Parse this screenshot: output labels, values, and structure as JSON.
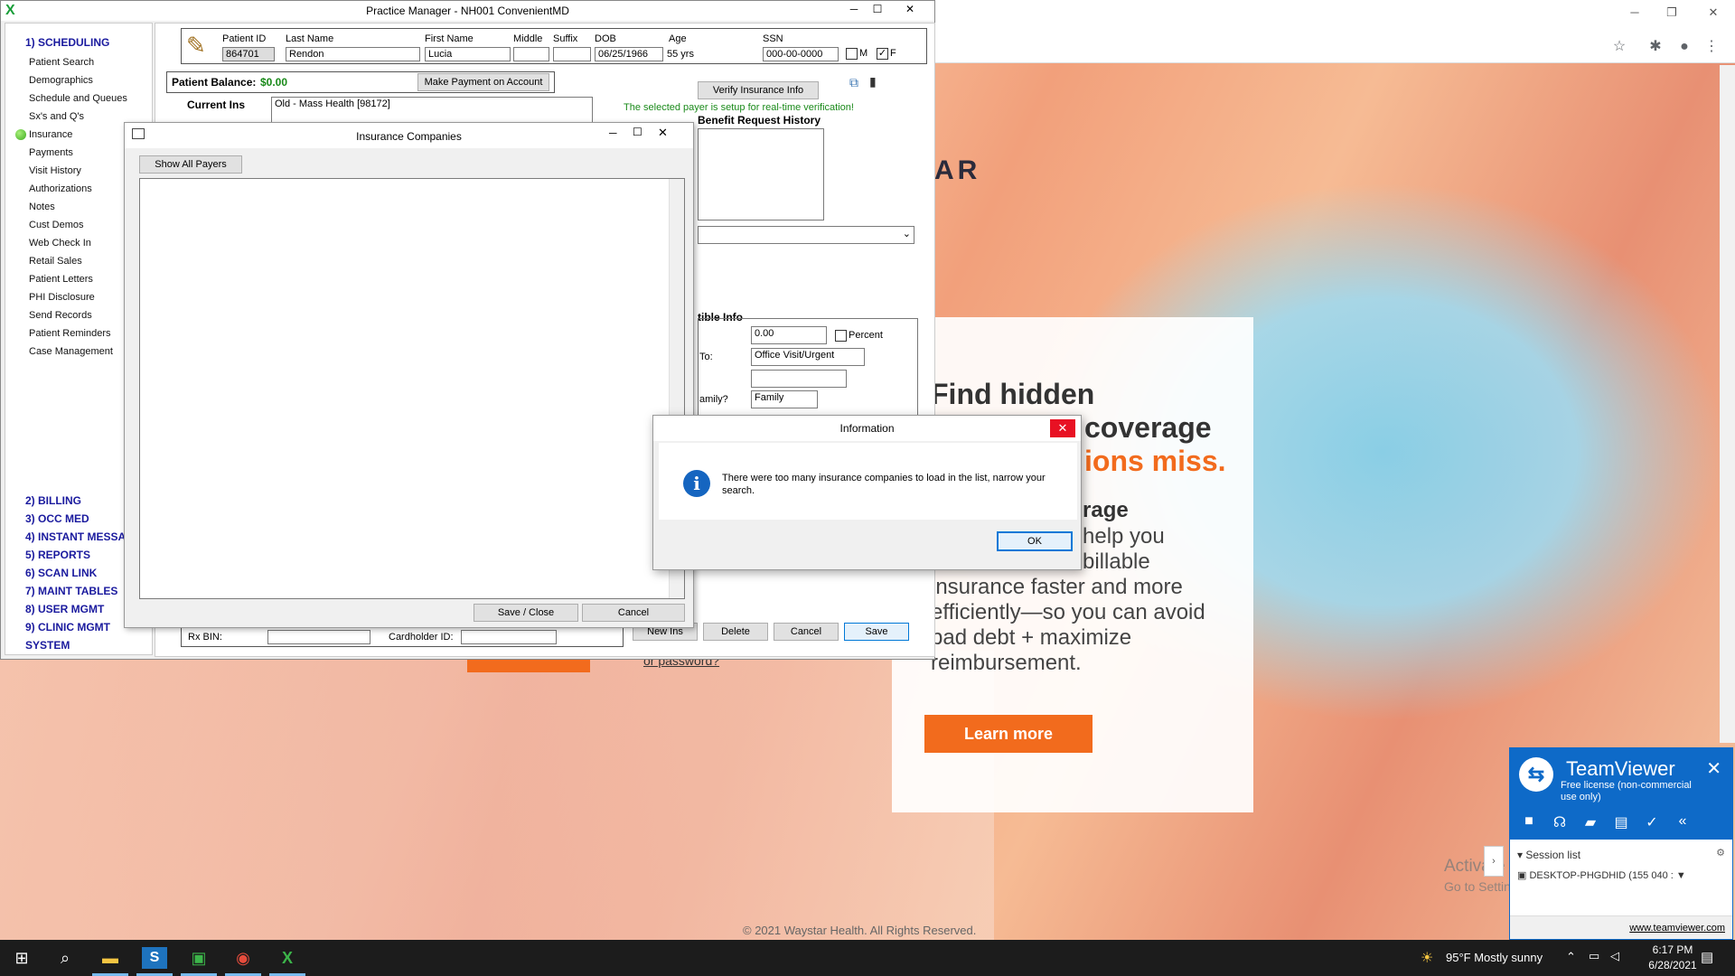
{
  "browser": {
    "hero_line1": "Find hidden",
    "hero_line2": "coverage",
    "hero_line3": "ions miss.",
    "brand_fragment": "AR",
    "sub_heading": "rage",
    "sub_lines": [
      "help you",
      "billable",
      "insurance faster and more",
      "efficiently—so you can avoid",
      "bad debt + maximize",
      "reimbursement."
    ],
    "learn_more": "Learn more",
    "password_link": "or password?",
    "copyright": "© 2021 Waystar Health. All Rights Reserved.",
    "activate_line1": "Activate Windows",
    "activate_line2": "Go to Settin"
  },
  "teamviewer": {
    "title": "TeamViewer",
    "subtitle": "Free license (non-commercial use only)",
    "session_list": "Session list",
    "device": "DESKTOP-PHGDHID (155 040 :",
    "link": "www.teamviewer.com"
  },
  "app": {
    "title": "Practice Manager - NH001 ConvenientMD",
    "nav": {
      "scheduling": "1) SCHEDULING",
      "items": [
        "Patient Search",
        "Demographics",
        "Schedule and Queues",
        "Sx's and Q's",
        "Insurance",
        "Payments",
        "Visit History",
        "Authorizations",
        "Notes",
        "Cust Demos",
        "Web Check In",
        "Retail Sales",
        "Patient Letters",
        "PHI Disclosure",
        "Send Records",
        "Patient Reminders",
        "Case Management"
      ],
      "modules": [
        "2) BILLING",
        "3) OCC MED",
        "4) INSTANT MESSAG",
        "5) REPORTS",
        "6) SCAN LINK",
        "7) MAINT TABLES",
        "8) USER MGMT",
        "9) CLINIC MGMT",
        "SYSTEM"
      ]
    },
    "patient": {
      "id_label": "Patient ID",
      "id": "864701",
      "last_label": "Last Name",
      "last": "Rendon",
      "first_label": "First Name",
      "first": "Lucia",
      "middle_label": "Middle",
      "middle": "",
      "suffix_label": "Suffix",
      "suffix": "",
      "dob_label": "DOB",
      "dob": "06/25/1966",
      "age_label": "Age",
      "age": "55 yrs",
      "ssn_label": "SSN",
      "ssn": "000-00-0000",
      "m_label": "M",
      "f_label": "F"
    },
    "balance_label": "Patient Balance:",
    "balance": "$0.00",
    "make_payment": "Make Payment on Account",
    "verify_ins": "Verify Insurance Info",
    "current_ins_label": "Current Ins",
    "current_ins": "Old - Mass Health  [98172]",
    "realtime_msg": "The selected payer is setup for real-time verification!",
    "benefit_history": "Benefit Request History",
    "deductible_info": "tible Info",
    "amount": "0.00",
    "percent_label": "Percent",
    "to_label": "To:",
    "to_value": "Office Visit/Urgent",
    "family_label": "amily?",
    "family_value": "Family",
    "rx_bin_label": "Rx BIN:",
    "cardholder_label": "Cardholder ID:",
    "new_ins": "New Ins",
    "delete": "Delete",
    "cancel": "Cancel",
    "save": "Save"
  },
  "insurance_dialog": {
    "title": "Insurance Companies",
    "show_all": "Show All Payers",
    "save_close": "Save / Close",
    "cancel": "Cancel"
  },
  "info_dialog": {
    "title": "Information",
    "message": "There were too many insurance companies to load in the list, narrow your search.",
    "ok": "OK"
  },
  "taskbar": {
    "weather": "95°F  Mostly sunny",
    "time": "6:17 PM",
    "date": "6/28/2021"
  }
}
